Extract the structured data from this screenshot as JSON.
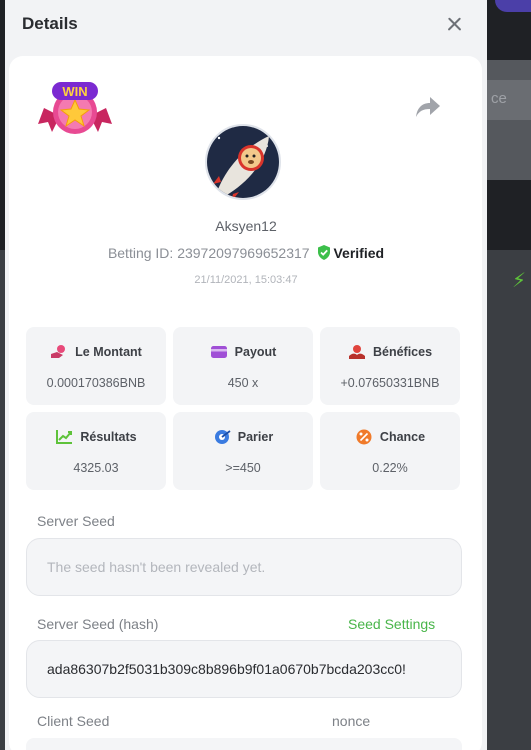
{
  "background": {
    "input_fragment": "ce"
  },
  "modal": {
    "title": "Details"
  },
  "bet": {
    "username": "Aksyen12",
    "betting_id_label": "Betting ID:",
    "betting_id": "23972097969652317",
    "verified_label": "Verified",
    "datetime": "21/11/2021, 15:03:47",
    "badge": "WIN"
  },
  "stats": [
    {
      "label": "Le Montant",
      "value": "0.000170386BNB",
      "icon": "coin-hand-icon",
      "color": "#e84a7a"
    },
    {
      "label": "Payout",
      "value": "450 x",
      "icon": "wallet-icon",
      "color": "#a04fd6"
    },
    {
      "label": "Bénéfices",
      "value": "+0.07650331BNB",
      "icon": "money-hand-icon",
      "color": "#e0443d"
    },
    {
      "label": "Résultats",
      "value": "4325.03",
      "icon": "chart-up-icon",
      "color": "#5ec23a"
    },
    {
      "label": "Parier",
      "value": ">=450",
      "icon": "target-icon",
      "color": "#3a7be0"
    },
    {
      "label": "Chance",
      "value": "0.22%",
      "icon": "percent-icon",
      "color": "#f07a2a"
    }
  ],
  "server_seed": {
    "label": "Server Seed",
    "placeholder": "The seed hasn't been revealed yet."
  },
  "server_seed_hash": {
    "label": "Server Seed (hash)",
    "settings_link": "Seed Settings",
    "value": "ada86307b2f5031b309c8b896b9f01a0670b7bcda203cc0!"
  },
  "client_seed": {
    "label": "Client Seed"
  },
  "nonce": {
    "label": "nonce"
  }
}
